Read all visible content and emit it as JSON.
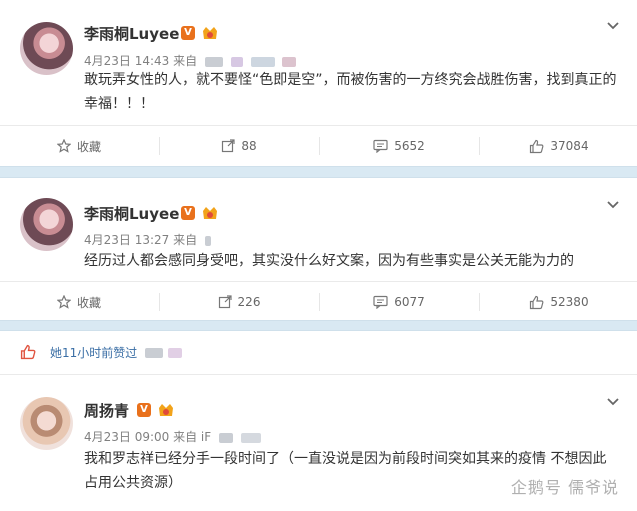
{
  "posts": [
    {
      "author": "李雨桐Luyee",
      "badge_v": "V",
      "meta_date": "4月23日 14:43 来自",
      "text": "敢玩弄女性的人，就不要怪“色即是空”，而被伤害的一方终究会战胜伤害，找到真正的幸福！！！",
      "actions": {
        "favorite": "收藏",
        "repost": "88",
        "comment": "5652",
        "like": "37084"
      }
    },
    {
      "author": "李雨桐Luyee",
      "badge_v": "V",
      "meta_date": "4月23日 13:27 来自",
      "text": "经历过人都会感同身受吧，其实没什么好文案，因为有些事实是公关无能为力的",
      "actions": {
        "favorite": "收藏",
        "repost": "226",
        "comment": "6077",
        "like": "52380"
      }
    },
    {
      "author": "周扬青",
      "badge_v": "V",
      "meta_date": "4月23日 09:00 来自 iF",
      "text": "我和罗志祥已经分手一段时间了（一直没说是因为前段时间突如其来的疫情 不想因此占用公共资源）"
    }
  ],
  "liked_notice": "她11小时前赞过",
  "watermark": "企鹅号 儒爷说",
  "colors": {
    "band": "#d9e9f3",
    "link": "#3a6ea5",
    "v_badge": "#e9711c"
  }
}
